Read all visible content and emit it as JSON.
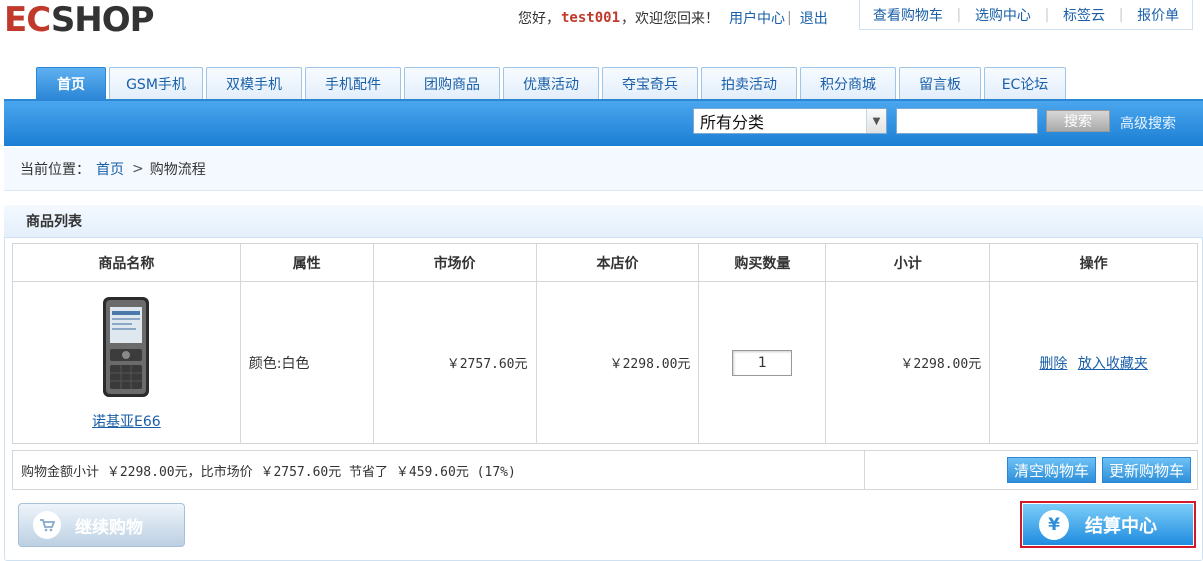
{
  "logo": {
    "text_ec": "EC",
    "text_rest": "SHOP"
  },
  "header": {
    "greeting": "您好，",
    "username": "test001",
    "welcome_back": "，欢迎您回来！",
    "user_center": "用户中心",
    "divider": "|",
    "logout": "退出",
    "top_links": [
      "查看购物车",
      "选购中心",
      "标签云",
      "报价单"
    ]
  },
  "nav": {
    "tabs": [
      {
        "label": "首页",
        "active": true
      },
      {
        "label": "GSM手机",
        "active": false
      },
      {
        "label": "双模手机",
        "active": false
      },
      {
        "label": "手机配件",
        "active": false
      },
      {
        "label": "团购商品",
        "active": false
      },
      {
        "label": "优惠活动",
        "active": false
      },
      {
        "label": "夺宝奇兵",
        "active": false
      },
      {
        "label": "拍卖活动",
        "active": false
      },
      {
        "label": "积分商城",
        "active": false
      },
      {
        "label": "留言板",
        "active": false
      },
      {
        "label": "EC论坛",
        "active": false
      }
    ]
  },
  "search": {
    "category_selected": "所有分类",
    "keyword_value": "",
    "button_label": "搜索",
    "advanced_label": "高级搜索"
  },
  "breadcrumb": {
    "prefix": "当前位置：",
    "home": "首页",
    "separator": ">",
    "current": "购物流程"
  },
  "cart": {
    "title": "商品列表",
    "columns": [
      "商品名称",
      "属性",
      "市场价",
      "本店价",
      "购买数量",
      "小计",
      "操作"
    ],
    "items": [
      {
        "name": "诺基亚E66",
        "attribute": "颜色:白色",
        "market_price": "￥2757.60元",
        "shop_price": "￥2298.00元",
        "quantity": "1",
        "subtotal": "￥2298.00元",
        "actions": [
          "删除",
          "放入收藏夹"
        ]
      }
    ],
    "summary": "购物金额小计 ￥2298.00元，比市场价 ￥2757.60元 节省了 ￥459.60元 (17%)",
    "clear_label": "清空购物车",
    "update_label": "更新购物车",
    "continue_label": "继续购物",
    "checkout_label": "结算中心"
  },
  "icons": {
    "continue": "cart-icon",
    "checkout": "yen-icon"
  },
  "colors": {
    "accent": "#2b86d6",
    "link": "#1a5fa8",
    "highlight_border": "#d0192a",
    "username": "#c0392b"
  }
}
